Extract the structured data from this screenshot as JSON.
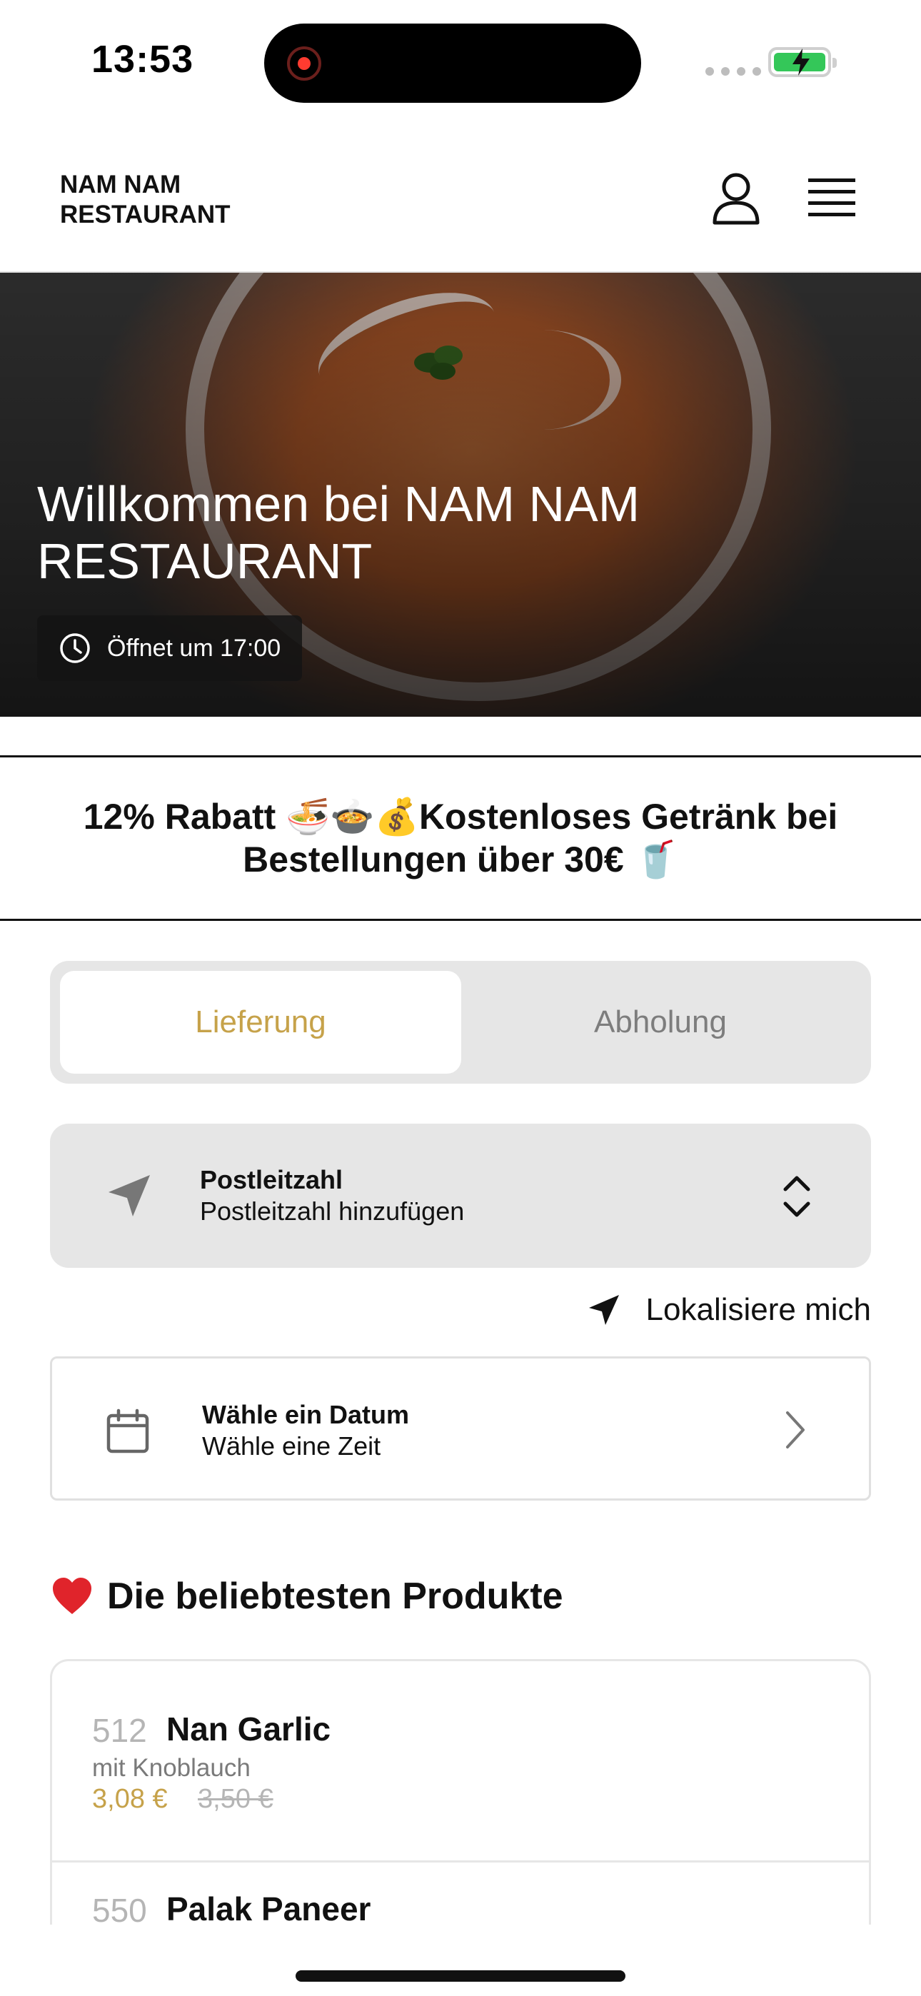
{
  "status_bar": {
    "time": "13:53",
    "battery_state": "charging",
    "battery_color": "#34c759"
  },
  "header": {
    "brand": "NAM NAM RESTAURANT",
    "icons": [
      "user-icon",
      "hamburger-menu-icon"
    ]
  },
  "hero": {
    "title": "Willkommen bei NAM NAM RESTAURANT",
    "open_badge": "Öffnet um 17:00"
  },
  "promo": {
    "text": "12% Rabatt 🍜🍲💰Kostenloses Getränk bei Bestellungen über 30€ 🥤"
  },
  "delivery_toggle": {
    "options": [
      "Lieferung",
      "Abholung"
    ],
    "selected": "Lieferung",
    "accent_color": "#c6a24a"
  },
  "postcode": {
    "title": "Postleitzahl",
    "placeholder": "Postleitzahl hinzufügen"
  },
  "locate": {
    "label": "Lokalisiere mich"
  },
  "date_picker": {
    "title": "Wähle ein Datum",
    "subtitle": "Wähle eine Zeit"
  },
  "popular": {
    "title": "Die beliebtesten Produkte",
    "emoji": "❤️",
    "products": [
      {
        "number": "512",
        "name": "Nan Garlic",
        "description": "mit Knoblauch",
        "price": "3,08 €",
        "old_price": "3,50 €"
      },
      {
        "number": "550",
        "name": "Palak Paneer",
        "description": "",
        "price": "",
        "old_price": ""
      }
    ]
  }
}
